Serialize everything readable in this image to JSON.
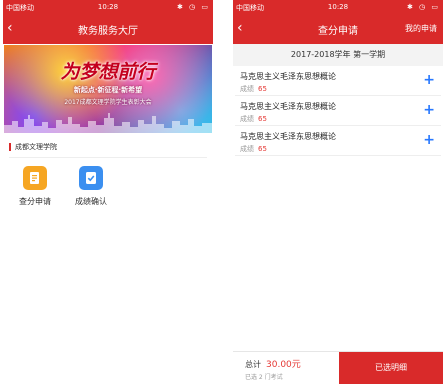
{
  "left_screen": {
    "status": {
      "carrier": "中国移动",
      "time": "10:28",
      "indicators": "✱ ◷ ▭"
    },
    "nav": {
      "title": "教务服务大厅",
      "back": "‹"
    },
    "banner": {
      "slogan": "为梦想前行",
      "subtitle": "新起点·新征程·新希望",
      "caption": "2017成都文理学院学生表彰大会"
    },
    "section": {
      "title": "成都文理学院"
    },
    "tiles": [
      {
        "label": "查分申请",
        "icon": "doc-search-icon",
        "color": "#f6a623"
      },
      {
        "label": "成绩确认",
        "icon": "check-doc-icon",
        "color": "#3b8ff0"
      }
    ]
  },
  "right_screen": {
    "status": {
      "carrier": "中国移动",
      "time": "10:28",
      "indicators": "✱ ◷ ▭"
    },
    "nav": {
      "title": "查分申请",
      "back": "‹",
      "right": "我的申请"
    },
    "term": "2017-2018学年  第一学期",
    "courses": [
      {
        "name": "马克思主义毛泽东思想概论",
        "score_label": "成绩",
        "score": "65",
        "action": "+"
      },
      {
        "name": "马克思主义毛泽东思想概论",
        "score_label": "成绩",
        "score": "65",
        "action": "+"
      },
      {
        "name": "马克思主义毛泽东思想概论",
        "score_label": "成绩",
        "score": "65",
        "action": "+"
      }
    ],
    "footer": {
      "total_label": "总计",
      "total_amount": "30.00元",
      "selected_text": "已选 2 门考试",
      "button": "已选明细"
    }
  },
  "colors": {
    "primary": "#d92a2a",
    "score": "#e53935",
    "plus": "#2979ff"
  }
}
